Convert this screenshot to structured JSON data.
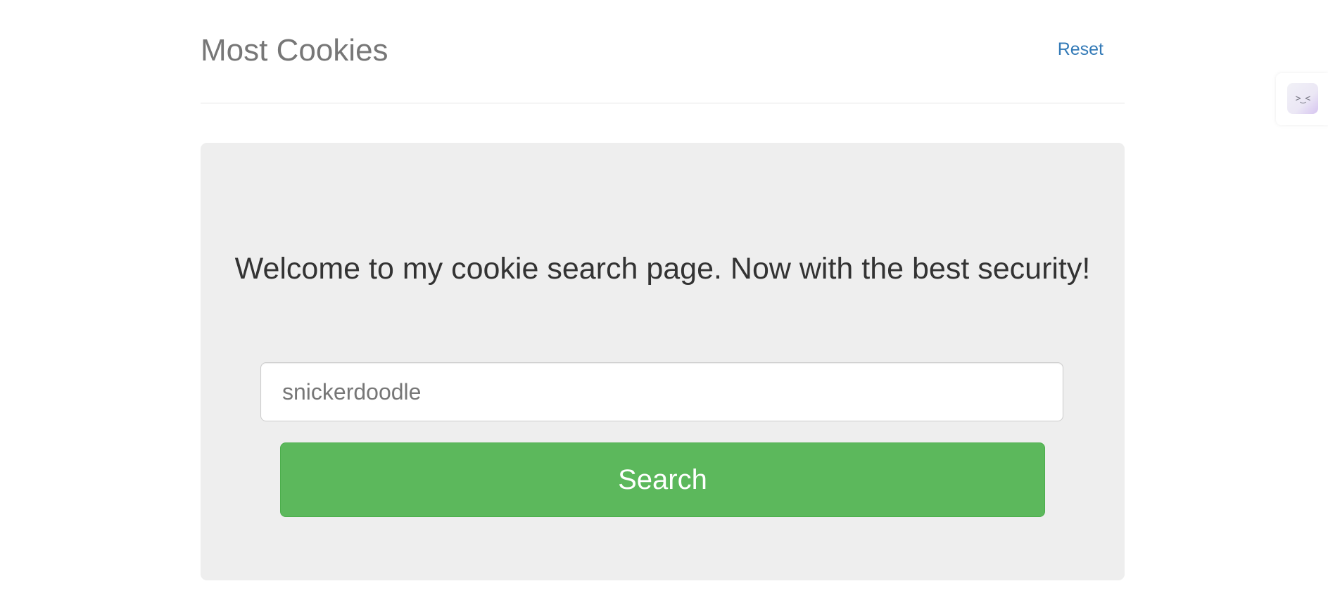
{
  "header": {
    "brand": "Most Cookies",
    "reset_label": "Reset"
  },
  "main": {
    "welcome_text": "Welcome to my cookie search page. Now with the best security!",
    "search": {
      "placeholder": "snickerdoodle",
      "value": ""
    },
    "search_button_label": "Search"
  },
  "extension": {
    "icon": "face-icon",
    "glyph": ">‿<"
  },
  "colors": {
    "accent_link": "#337ab7",
    "button_green": "#5cb85c",
    "jumbotron_bg": "#eeeeee"
  }
}
